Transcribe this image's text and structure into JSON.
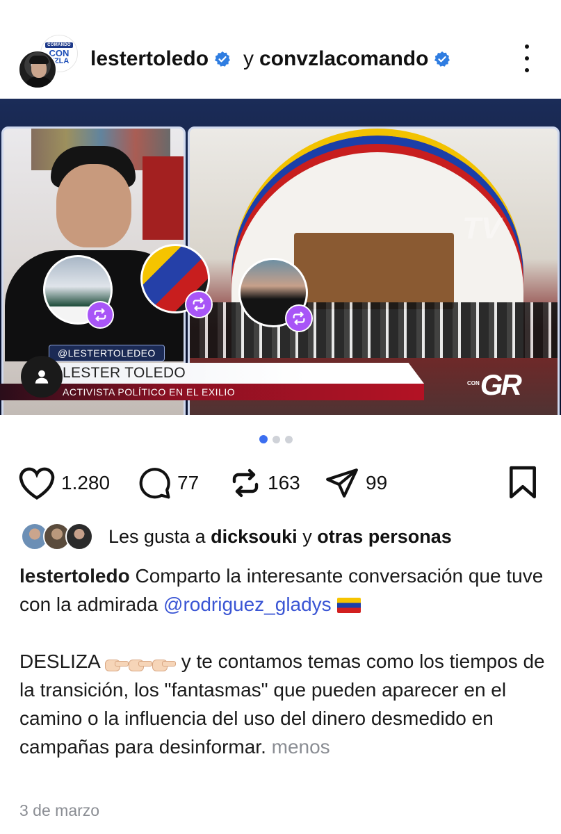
{
  "header": {
    "logo_line1": "COMANDO",
    "logo_line2": "CON",
    "logo_line3": "VZLA",
    "username_primary": "lestertoledo",
    "connector": "y",
    "username_secondary": "convzlacomando",
    "verified_color": "#2f7de1"
  },
  "media": {
    "watermark": "TV",
    "handle_tag": "@LESTERTOLEDEO",
    "lower_third_name": "LESTER TOLEDO",
    "lower_third_role": "ACTIVISTA POLÍTICO EN EL EXILIO",
    "brand_prefix": "CON",
    "brand_logo": "GR",
    "repost_badge_color": "#a855f7",
    "carousel_index": 1,
    "carousel_total": 3
  },
  "actions": {
    "likes": "1.280",
    "comments": "77",
    "reposts": "163",
    "shares": "99"
  },
  "likes_line": {
    "prefix": "Les gusta a",
    "user": "dicksouki",
    "connector": "y",
    "others": "otras personas"
  },
  "caption": {
    "user": "lestertoledo",
    "text1": " Comparto la interesante conversación que tuve con la admirada ",
    "mention": "@rodriguez_gladys",
    "para2_start": "DESLIZA ",
    "para2_rest": " y te contamos temas como los tiempos de la transición, los \"fantasmas\" que pueden aparecer en el camino o la influencia del uso del dinero desmedido en campañas para desinformar.",
    "less": " menos",
    "accent_color": "#3a55d4"
  },
  "date": "3 de marzo"
}
